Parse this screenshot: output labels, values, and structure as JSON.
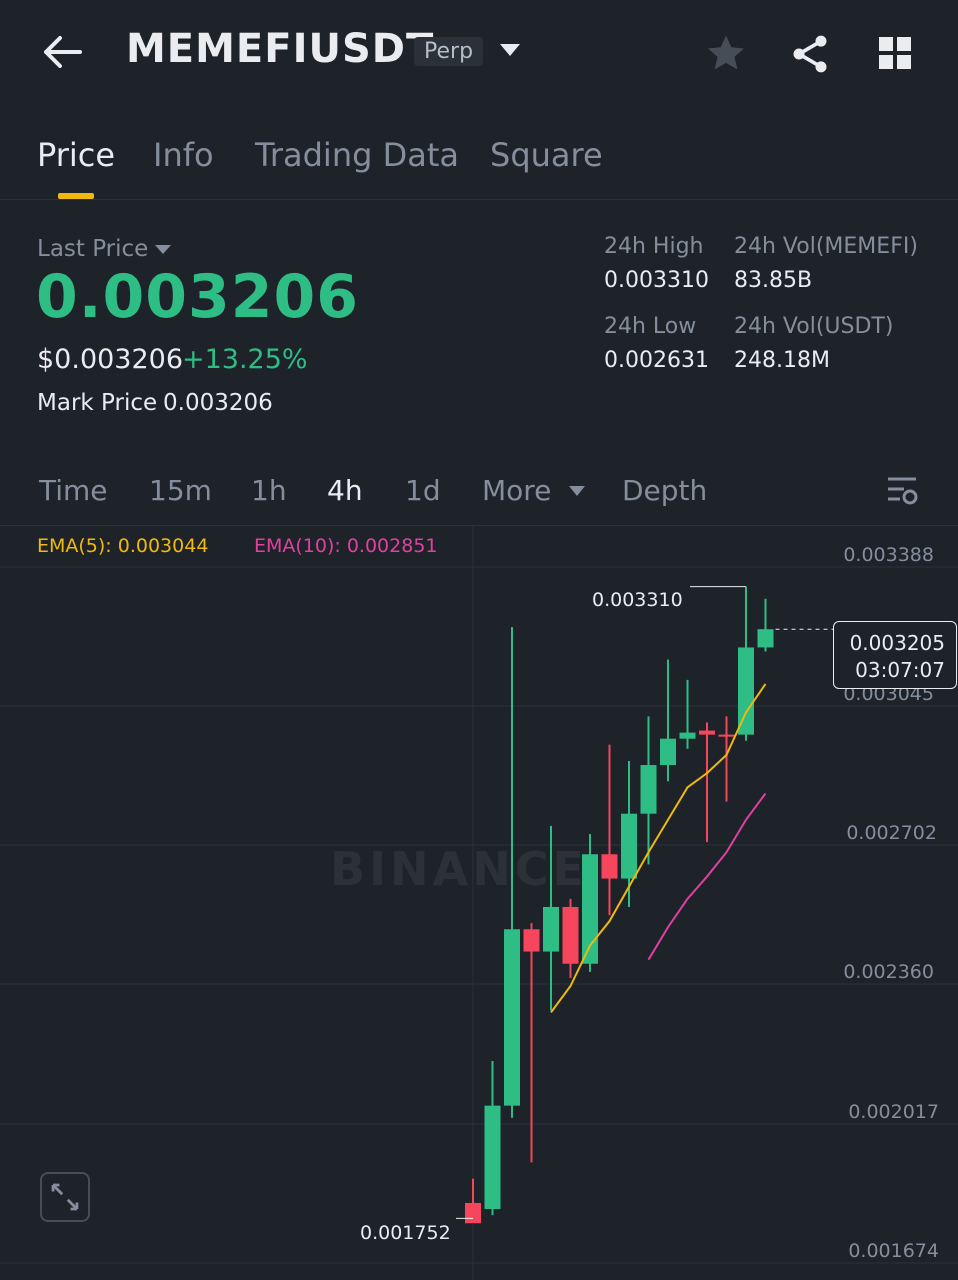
{
  "header": {
    "symbol": "MEMEFIUSDT",
    "contract_badge": "Perp",
    "icons": [
      "back-arrow-icon",
      "chevron-down-icon",
      "star-icon",
      "share-icon",
      "grid-icon"
    ]
  },
  "tabs": [
    {
      "label": "Price",
      "active": true
    },
    {
      "label": "Info",
      "active": false
    },
    {
      "label": "Trading Data",
      "active": false
    },
    {
      "label": "Square",
      "active": false
    }
  ],
  "price": {
    "last_label": "Last Price",
    "last_price": "0.003206",
    "usd_price": "$0.003206",
    "change_pct": "+13.25%",
    "mark_label": "Mark Price",
    "mark_price": "0.003206"
  },
  "stats": {
    "high_label": "24h High",
    "high": "0.003310",
    "low_label": "24h Low",
    "low": "0.002631",
    "vol_base_label": "24h Vol(MEMEFI)",
    "vol_base": "83.85B",
    "vol_quote_label": "24h Vol(USDT)",
    "vol_quote": "248.18M"
  },
  "timeframes": {
    "items": [
      "Time",
      "15m",
      "1h",
      "4h",
      "1d",
      "More",
      "Depth"
    ],
    "active": "4h"
  },
  "indicators": {
    "ema5": "EMA(5): 0.003044",
    "ema10": "EMA(10): 0.002851"
  },
  "watermark": "BINANCE",
  "colors": {
    "up": "#2ebd85",
    "down": "#f6465d",
    "ema5": "#f0b90b",
    "ema10": "#e040a0",
    "accent": "#f0b90b",
    "background": "#1e2329"
  },
  "chart_data": {
    "type": "candlestick",
    "interval": "4h",
    "y_ticks": [
      "0.003388",
      "0.003045",
      "0.002702",
      "0.002360",
      "0.002017",
      "0.001674"
    ],
    "ylim": [
      0.001674,
      0.003388
    ],
    "current_price": "0.003205",
    "countdown": "03:07:07",
    "high_annotation": "0.003310",
    "low_annotation": "0.001752",
    "candles": [
      {
        "o": 0.00179,
        "h": 0.00185,
        "l": 0.001752,
        "c": 0.00174
      },
      {
        "o": 0.001775,
        "h": 0.00214,
        "l": 0.00176,
        "c": 0.00203
      },
      {
        "o": 0.00203,
        "h": 0.00321,
        "l": 0.002,
        "c": 0.002465
      },
      {
        "o": 0.002465,
        "h": 0.00248,
        "l": 0.00189,
        "c": 0.00241
      },
      {
        "o": 0.00241,
        "h": 0.00272,
        "l": 0.002265,
        "c": 0.00252
      },
      {
        "o": 0.00252,
        "h": 0.00254,
        "l": 0.002345,
        "c": 0.00238
      },
      {
        "o": 0.00238,
        "h": 0.0027,
        "l": 0.00236,
        "c": 0.00265
      },
      {
        "o": 0.00265,
        "h": 0.00292,
        "l": 0.0025,
        "c": 0.00259
      },
      {
        "o": 0.00259,
        "h": 0.00288,
        "l": 0.00252,
        "c": 0.00275
      },
      {
        "o": 0.00275,
        "h": 0.00299,
        "l": 0.002625,
        "c": 0.00287
      },
      {
        "o": 0.00287,
        "h": 0.00313,
        "l": 0.00283,
        "c": 0.002935
      },
      {
        "o": 0.002935,
        "h": 0.00308,
        "l": 0.00291,
        "c": 0.00295
      },
      {
        "o": 0.002955,
        "h": 0.002975,
        "l": 0.00268,
        "c": 0.002945
      },
      {
        "o": 0.002945,
        "h": 0.00299,
        "l": 0.00278,
        "c": 0.00294
      },
      {
        "o": 0.002945,
        "h": 0.00331,
        "l": 0.00293,
        "c": 0.00316
      },
      {
        "o": 0.00316,
        "h": 0.00328,
        "l": 0.00315,
        "c": 0.003205
      }
    ],
    "ema5_series": [
      null,
      null,
      null,
      null,
      0.00226,
      0.002325,
      0.002425,
      0.002485,
      0.00257,
      0.002655,
      0.002735,
      0.002815,
      0.00285,
      0.002895,
      0.003,
      0.00307
    ],
    "ema10_series": [
      null,
      null,
      null,
      null,
      null,
      null,
      null,
      null,
      null,
      0.00239,
      0.00247,
      0.00254,
      0.002595,
      0.002655,
      0.002735,
      0.0028
    ]
  }
}
